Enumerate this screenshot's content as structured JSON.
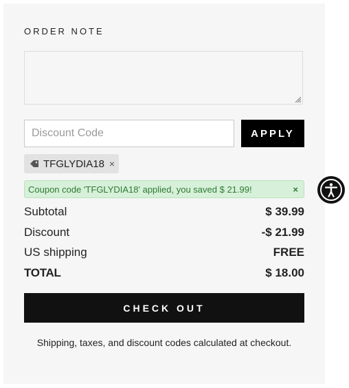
{
  "order_note": {
    "label": "ORDER NOTE"
  },
  "discount": {
    "placeholder": "Discount Code",
    "apply_label": "APPLY",
    "applied_code": "TFGLYDIA18",
    "remove_glyph": "×",
    "success_message": "Coupon code 'TFGLYDIA18' applied, you saved $ 21.99!",
    "dismiss_glyph": "×"
  },
  "summary": {
    "rows": [
      {
        "label": "Subtotal",
        "value": "$ 39.99"
      },
      {
        "label": "Discount",
        "value": "-$ 21.99"
      },
      {
        "label": "US shipping",
        "value": "FREE"
      },
      {
        "label": "TOTAL",
        "value": "$ 18.00"
      }
    ]
  },
  "checkout": {
    "button_label": "CHECK OUT",
    "note": "Shipping, taxes, and discount codes calculated at checkout."
  },
  "icons": {
    "tag": "tag-icon",
    "accessibility": "accessibility-icon"
  },
  "colors": {
    "panel_bg": "#f6f6f6",
    "button_bg": "#111111",
    "success_bg": "#d7f0d9",
    "success_text": "#2d7a33"
  }
}
